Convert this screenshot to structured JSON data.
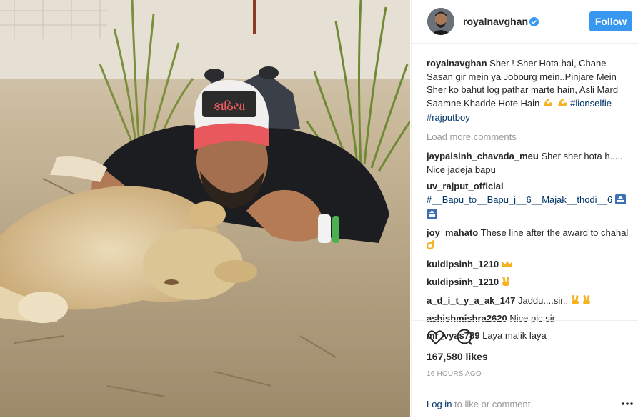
{
  "header": {
    "username": "royalnavghan",
    "follow_label": "Follow"
  },
  "caption": {
    "username": "royalnavghan",
    "text": "Sher ! Sher Hota hai, Chahe Sasan gir mein ya Jobourg mein..Pinjare Mein Sher ko bahut log pathar marte hain, Asli Mard Saamne Khadde Hote Hain",
    "tag1": "#lionselfie",
    "tag2": "#rajputboy"
  },
  "load_more": "Load more comments",
  "comments": [
    {
      "user": "jaypalsinh_chavada_meu",
      "text": "Sher sher hota h..... Nice jadeja bapu"
    },
    {
      "user": "uv_rajput_official",
      "text": "#__Bapu_to__Bapu_j__6__Majak__thodi__6"
    },
    {
      "user": "joy_mahato",
      "text": "These line after the award to chahal"
    },
    {
      "user": "kuldipsinh_1210",
      "text": ""
    },
    {
      "user": "kuldipsinh_1210",
      "text": ""
    },
    {
      "user": "a_d_i_t_y_a_ak_147",
      "text": "Jaddu....sir.."
    },
    {
      "user": "ashishmishra2620",
      "text": "Nice pic sir"
    },
    {
      "user": "mr_vyas789",
      "text": "Laya malik laya"
    }
  ],
  "cap_text": "કાઠિયા",
  "likes": "167,580 likes",
  "timestamp": "16 HOURS AGO",
  "footer": {
    "login": "Log in",
    "rest": "to like or comment."
  },
  "colors": {
    "accent": "#3897f0",
    "link": "#003569",
    "muted": "#999999"
  },
  "icons": [
    "verified-badge-icon",
    "heart-icon",
    "comment-icon",
    "more-options-icon",
    "flexed-biceps-emoji",
    "ok-hand-emoji",
    "top-arrow-emoji",
    "crown-emoji",
    "victory-hand-emoji"
  ]
}
